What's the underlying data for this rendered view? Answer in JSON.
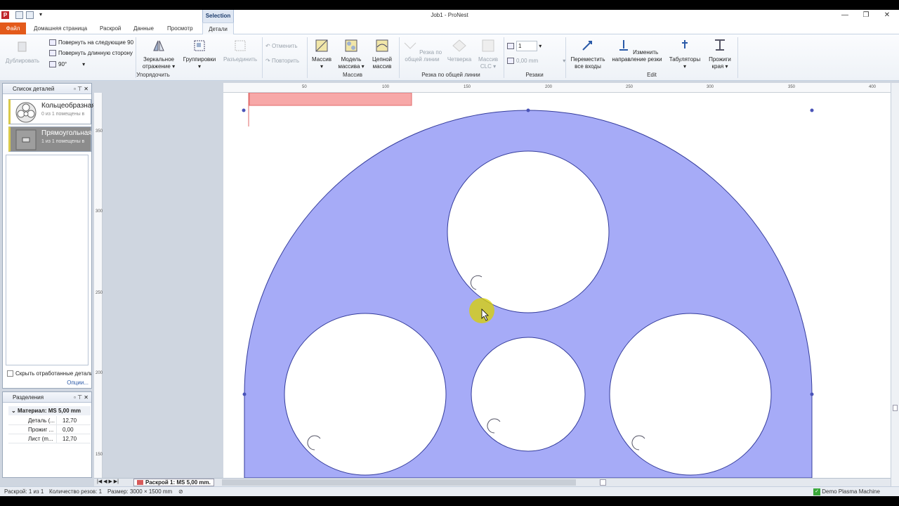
{
  "window": {
    "title": "Job1 - ProNest",
    "app_letter": "P",
    "context_tab": "Selection",
    "controls": [
      "—",
      "❐",
      "✕"
    ]
  },
  "tabs": {
    "file": "Файл",
    "home": "Домашняя страница",
    "nest": "Раскрой",
    "data": "Данные",
    "view": "Просмотр",
    "details": "Детали"
  },
  "ribbon": {
    "duplicate": "Дублировать",
    "rotate_next": "Повернуть на следующие 90",
    "rotate_long": "Повернуть длинную сторону",
    "angle": "90°",
    "mirror": "Зеркальное отражение",
    "groups": "Группировки",
    "ungroup": "Разъединить",
    "undo": "Отменить",
    "redo": "Повторить",
    "arrange_group": "Упорядочить",
    "array": "Массив",
    "array_model": "Модель массива",
    "chain_array": "Цепной массив",
    "array_group": "Массив",
    "common_line_cut": "Резка по общей линии",
    "quarter": "Четверка",
    "clc_array": "Массив CLC",
    "common_line_group": "Резка по общей линии",
    "cuts_count": "1",
    "cuts_mm": "0,00 mm",
    "cuts_group": "Резаки",
    "move_leads": "Переместить все входы",
    "change_direction": "Изменить направление резки",
    "tabs_btn": "Табуляторы",
    "edge_pierce": "Прожиги края",
    "edit_group": "Edit"
  },
  "parts_panel": {
    "title": "Список деталей",
    "items": [
      {
        "name": "Кольцеобразная",
        "sub": "0 из 1 помещены в"
      },
      {
        "name": "Прямоугольная",
        "sub": "1 из 1 помещены в"
      }
    ],
    "hide_label": "Скрыть отработанные детали",
    "options": "Опции..."
  },
  "separations_panel": {
    "title": "Разделения",
    "material": "Материал: MS 5,00 mm",
    "rows": [
      {
        "k": "Деталь (...",
        "v": "12,70"
      },
      {
        "k": "Прожиг ...",
        "v": "0,00"
      },
      {
        "k": "Лист (m...",
        "v": "12,70"
      }
    ]
  },
  "ruler": {
    "top": [
      "50",
      "100",
      "150",
      "200",
      "250",
      "300",
      "350",
      "400"
    ],
    "left": [
      "350",
      "300",
      "250",
      "200",
      "150"
    ]
  },
  "sheet_tab": "Раскрой 1: MS 5,00 mm.",
  "status": {
    "nest": "Раскрой: 1 из 1",
    "cuts": "Количество резов: 1",
    "size": "Размер: 3000 × 1500 mm",
    "machine": "Demo Plasma Machine"
  },
  "colors": {
    "part_fill": "#a6abf7",
    "part_stroke": "#343c9c",
    "rect_part": "#f7a8a8",
    "cursor": "#d8d000",
    "file_tab": "#e35a1b"
  }
}
